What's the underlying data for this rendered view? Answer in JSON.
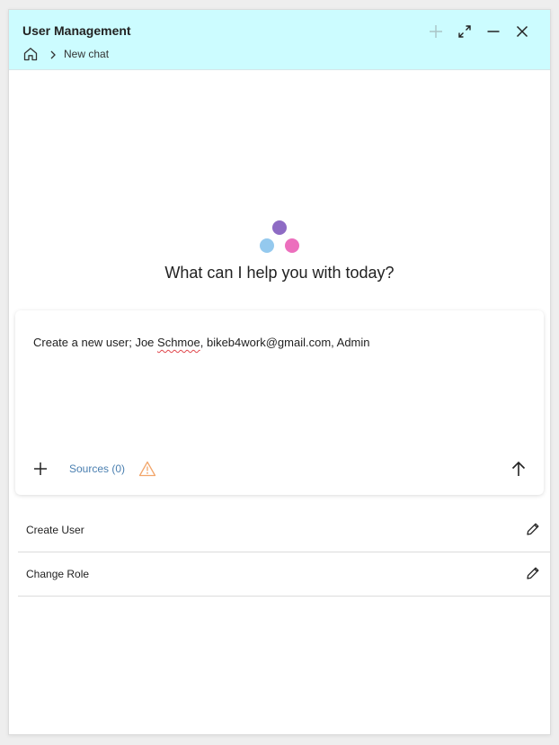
{
  "window": {
    "title": "User Management"
  },
  "breadcrumb": {
    "home_icon": "home-icon",
    "current": "New chat"
  },
  "window_controls": [
    "plus-icon",
    "expand-icon",
    "minimize-icon",
    "close-icon"
  ],
  "hero": {
    "prompt": "What can I help you with today?",
    "dot_colors": [
      "#8e6bc4",
      "#94c9ee",
      "#ec6fbd"
    ]
  },
  "composer": {
    "text_before": "Create a new user; Joe ",
    "text_misspelled": "Schmoe",
    "text_after": ", bikeb4work@gmail.com, Admin",
    "sources_label": "Sources (0)",
    "warning_color": "#f2a66b",
    "sources_color": "#4a7fb0"
  },
  "actions": [
    {
      "label": "Create User",
      "icon": "pencil-icon"
    },
    {
      "label": "Change Role",
      "icon": "pencil-icon"
    }
  ],
  "colors": {
    "header_bg": "#ccfcff"
  }
}
